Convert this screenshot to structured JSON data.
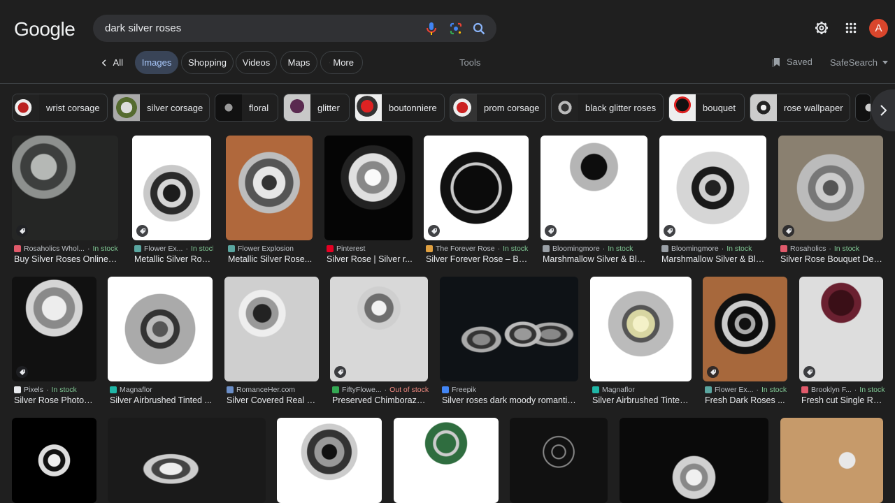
{
  "logo": "Google",
  "search": {
    "query": "dark silver roses"
  },
  "avatar_initial": "A",
  "tabs": [
    {
      "label": "All",
      "back": true
    },
    {
      "label": "Images",
      "active": true
    },
    {
      "label": "Shopping"
    },
    {
      "label": "Videos"
    },
    {
      "label": "Maps"
    },
    {
      "label": "More",
      "more": true
    }
  ],
  "tools_label": "Tools",
  "saved_label": "Saved",
  "safesearch_label": "SafeSearch",
  "chips": [
    "wrist corsage",
    "silver corsage",
    "floral",
    "glitter",
    "boutonniere",
    "prom corsage",
    "black glitter roses",
    "bouquet",
    "rose wallpaper"
  ],
  "results": [
    {
      "source": "Rosaholics Whol...",
      "stock": "In stock",
      "title": "Buy Silver Roses Online –..."
    },
    {
      "source": "Flower Ex...",
      "stock": "In stock",
      "title": "Metallic Silver Rose..."
    },
    {
      "source": "Flower Explosion",
      "stock": "",
      "title": "Metallic Silver Rose..."
    },
    {
      "source": "Pinterest",
      "stock": "",
      "title": "Silver Rose | Silver r..."
    },
    {
      "source": "The Forever Rose",
      "stock": "In stock",
      "title": "Silver Forever Rose – Bla..."
    },
    {
      "source": "Bloomingmore",
      "stock": "In stock",
      "title": "Marshmallow Silver & Bla..."
    },
    {
      "source": "Bloomingmore",
      "stock": "In stock",
      "title": "Marshmallow Silver & Bla..."
    },
    {
      "source": "Rosaholics",
      "stock": "In stock",
      "title": "Silver Rose Bouquet Deliv..."
    },
    {
      "source": "Pixels",
      "stock": "In stock",
      "title": "Silver Rose Photogr..."
    },
    {
      "source": "Magnaflor",
      "stock": "",
      "title": "Silver Airbrushed Tinted ..."
    },
    {
      "source": "RomanceHer.com",
      "stock": "",
      "title": "Silver Covered Real Ro..."
    },
    {
      "source": "FiftyFlowe...",
      "stock": "Out of stock",
      "title": "Preserved Chimborazo ..."
    },
    {
      "source": "Freepik",
      "stock": "",
      "title": "Silver roses dark moody romantic ..."
    },
    {
      "source": "Magnaflor",
      "stock": "",
      "title": "Silver Airbrushed Tinted ..."
    },
    {
      "source": "Flower Ex...",
      "stock": "In stock",
      "title": "Fresh Dark Roses ..."
    },
    {
      "source": "Brooklyn F...",
      "stock": "In stock",
      "title": "Fresh cut Single Re..."
    }
  ]
}
